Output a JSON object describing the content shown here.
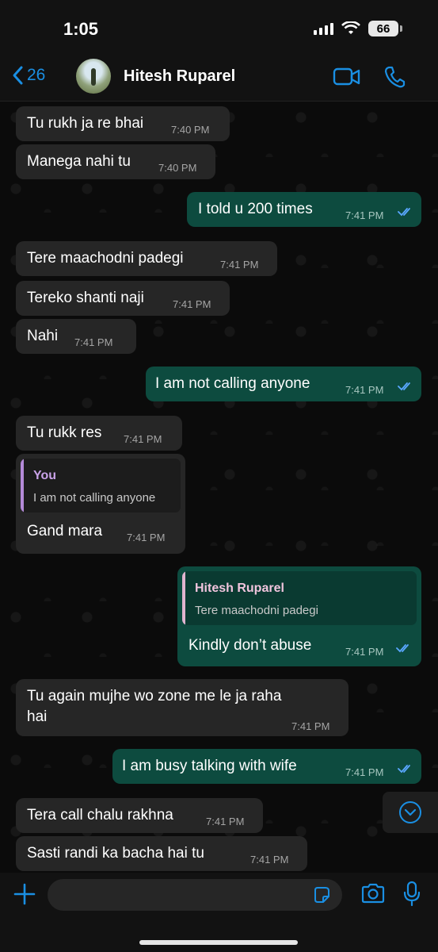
{
  "status_bar": {
    "time": "1:05",
    "battery": "66"
  },
  "header": {
    "back_count": "26",
    "contact_name": "Hitesh Ruparel"
  },
  "messages": [
    {
      "dir": "in",
      "text": "Tu rukh ja re bhai",
      "time": "7:40 PM"
    },
    {
      "dir": "in",
      "text": "Manega nahi tu",
      "time": "7:40 PM"
    },
    {
      "dir": "out",
      "text": "I told u 200 times",
      "time": "7:41 PM"
    },
    {
      "dir": "in",
      "text": "Tere maachodni padegi",
      "time": "7:41 PM"
    },
    {
      "dir": "in",
      "text": "Tereko shanti naji",
      "time": "7:41 PM"
    },
    {
      "dir": "in",
      "text": "Nahi",
      "time": "7:41 PM"
    },
    {
      "dir": "out",
      "text": "I am not calling anyone",
      "time": "7:41 PM"
    },
    {
      "dir": "in",
      "text": "Tu rukk res",
      "time": "7:41 PM"
    },
    {
      "dir": "in",
      "text": "Gand mara",
      "time": "7:41 PM",
      "quote": {
        "author": "You",
        "text": "I am not calling anyone"
      }
    },
    {
      "dir": "out",
      "text": "Kindly don’t abuse",
      "time": "7:41 PM",
      "quote": {
        "author": "Hitesh Ruparel",
        "text": "Tere maachodni padegi"
      }
    },
    {
      "dir": "in",
      "text_line1": "Tu again mujhe wo zone me le ja raha",
      "text_line2": "hai",
      "time": "7:41 PM"
    },
    {
      "dir": "out",
      "text": "I am busy talking with wife",
      "time": "7:41 PM"
    },
    {
      "dir": "in",
      "text": "Tera call chalu rakhna",
      "time": "7:41 PM"
    },
    {
      "dir": "in",
      "text": "Sasti randi ka bacha hai tu",
      "time": "7:41 PM"
    }
  ],
  "composer": {
    "value": ""
  },
  "colors": {
    "accent": "#1a8fe3",
    "incoming": "#262626",
    "outgoing": "#0d4b3f",
    "tick": "#5aa7ff",
    "quote_you": "#b48ad8",
    "quote_other": "#e0b4cf"
  }
}
